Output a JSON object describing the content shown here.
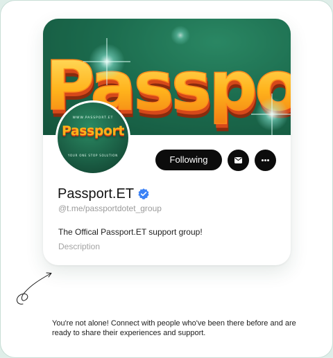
{
  "cover": {
    "banner_text": "Passpor"
  },
  "avatar": {
    "url_text": "WWW.PASSPORT.ET",
    "logo_text": "Passport",
    "tagline": "YOUR ONE STOP SOLUTION"
  },
  "actions": {
    "following_label": "Following",
    "message_icon": "envelope-icon",
    "more_icon": "more-horizontal-icon"
  },
  "profile": {
    "name": "Passport.ET",
    "handle": "@t.me/passportdotet_group",
    "description": "The Offical Passport.ET support group!",
    "description_label": "Description"
  },
  "caption": "You're not alone! Connect with people who've been there before and are ready to share their experiences and support.",
  "colors": {
    "cover_green": "#1c6b4e",
    "logo_gold": "#ffb21a",
    "logo_orange": "#e1501c",
    "button_black": "#0c0c0c",
    "verified_blue": "#3b82f6"
  }
}
